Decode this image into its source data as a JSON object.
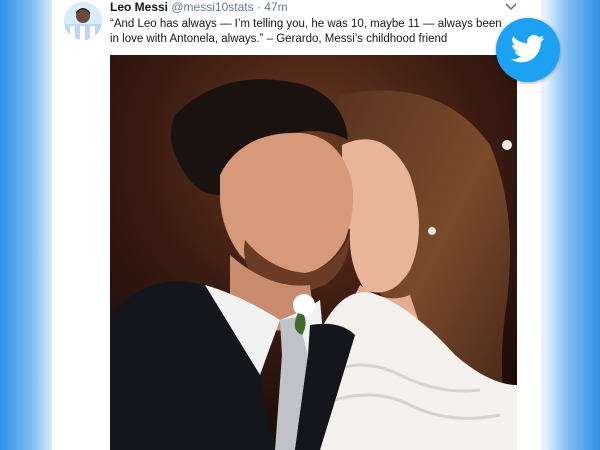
{
  "tweet": {
    "author_name": "Leo Messi",
    "author_handle": "@messi10stats",
    "separator": "·",
    "time_ago": "47m",
    "text": "“And Leo has always — I’m telling you, he was 10, maybe 11 — always been in love with Antonela, always.” – Gerardo, Messi’s childhood friend"
  },
  "icons": {
    "badge": "twitter-bird-icon",
    "menu": "chevron-down-icon",
    "avatar": "avatar-photo"
  },
  "colors": {
    "twitter_blue": "#1da1f2",
    "name_text": "#14171a",
    "meta_text": "#657786"
  }
}
